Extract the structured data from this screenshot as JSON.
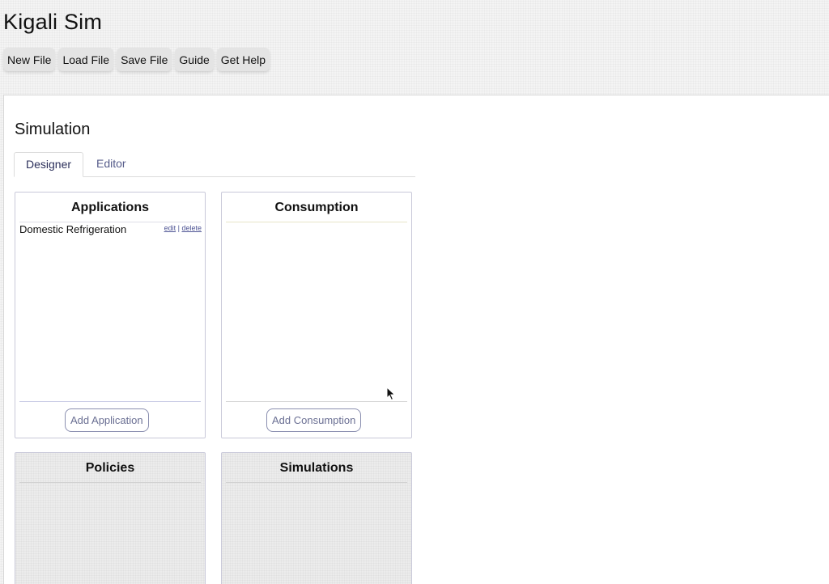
{
  "app": {
    "title": "Kigali Sim"
  },
  "toolbar": {
    "buttons": [
      "New File",
      "Load File",
      "Save File",
      "Guide",
      "Get Help"
    ]
  },
  "simulation": {
    "title": "Simulation",
    "tabs": {
      "designer": "Designer",
      "editor": "Editor",
      "active": "Designer"
    },
    "cards": {
      "applications": {
        "title": "Applications",
        "items": [
          {
            "name": "Domestic Refrigeration",
            "edit": "edit",
            "separator": "|",
            "delete": "delete"
          }
        ],
        "add_label": "Add Application"
      },
      "consumption": {
        "title": "Consumption",
        "add_label": "Add Consumption"
      },
      "policies": {
        "title": "Policies"
      },
      "simulations": {
        "title": "Simulations"
      }
    }
  },
  "icons": {
    "cursor": "mouse-pointer-icon"
  }
}
